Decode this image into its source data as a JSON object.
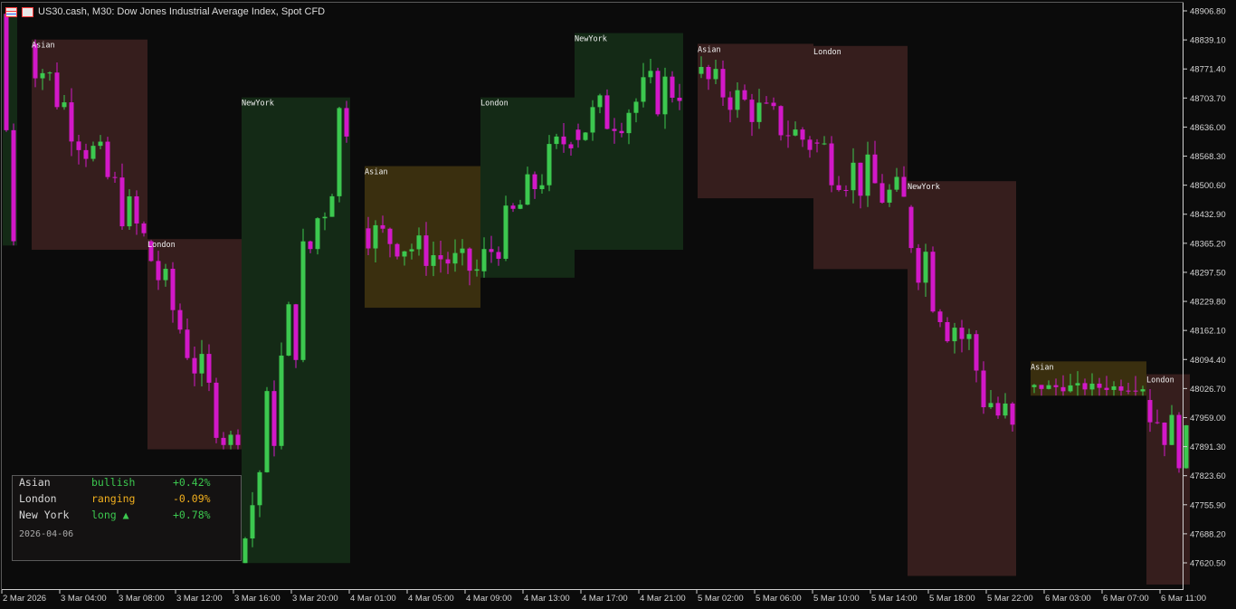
{
  "window": {
    "title": "US30.cash, M30:  Dow Jones Industrial Average Index, Spot CFD"
  },
  "colors": {
    "background": "#0b0b0b",
    "bull_candle": "#3cc84f",
    "bear_candle": "#d218c8",
    "asian_box": "#3a2f0f",
    "london_box": "#361e1d",
    "newyork_box": "#142a16",
    "axis_text": "#d4d4d4"
  },
  "price_axis": {
    "labels": [
      "48906.80",
      "48839.10",
      "48771.40",
      "48703.70",
      "48636.00",
      "48568.30",
      "48500.60",
      "48432.90",
      "48365.20",
      "48297.50",
      "48229.80",
      "48162.10",
      "48094.40",
      "48026.70",
      "47959.00",
      "47891.30",
      "47823.60",
      "47755.90",
      "47688.20",
      "47620.50"
    ]
  },
  "time_axis": {
    "labels": [
      "2 Mar 2026",
      "3 Mar 04:00",
      "3 Mar 08:00",
      "3 Mar 12:00",
      "3 Mar 16:00",
      "3 Mar 20:00",
      "4 Mar 01:00",
      "4 Mar 05:00",
      "4 Mar 09:00",
      "4 Mar 13:00",
      "4 Mar 17:00",
      "4 Mar 21:00",
      "5 Mar 02:00",
      "5 Mar 06:00",
      "5 Mar 10:00",
      "5 Mar 14:00",
      "5 Mar 18:00",
      "5 Mar 22:00",
      "6 Mar 03:00",
      "6 Mar 07:00",
      "6 Mar 11:00"
    ]
  },
  "sessions": [
    {
      "name": "",
      "type": "newyork",
      "open": 48900,
      "close": 48360,
      "high": 48900,
      "low": 48360
    },
    {
      "name": "Asian",
      "type": "london",
      "open": 48830,
      "close": 48370,
      "high": 48840,
      "low": 48350
    },
    {
      "name": "London",
      "type": "london",
      "open": 48370,
      "close": 47850,
      "high": 48375,
      "low": 47885
    },
    {
      "name": "NewYork",
      "type": "newyork",
      "open": 47620,
      "close": 48720,
      "high": 48705,
      "low": 47620
    },
    {
      "name": "Asian",
      "type": "asian",
      "open": 48400,
      "close": 48300,
      "high": 48545,
      "low": 48215
    },
    {
      "name": "London",
      "type": "newyork",
      "open": 48300,
      "close": 48630,
      "high": 48705,
      "low": 48285
    },
    {
      "name": "NewYork",
      "type": "newyork",
      "open": 48630,
      "close": 48740,
      "high": 48855,
      "low": 48350
    },
    {
      "name": "Asian",
      "type": "london",
      "open": 48760,
      "close": 48600,
      "high": 48830,
      "low": 48470
    },
    {
      "name": "London",
      "type": "london",
      "open": 48600,
      "close": 48450,
      "high": 48825,
      "low": 48305
    },
    {
      "name": "NewYork",
      "type": "london",
      "open": 48450,
      "close": 47890,
      "high": 48510,
      "low": 47590
    },
    {
      "name": "Asian",
      "type": "asian",
      "open": 48030,
      "close": 48030,
      "high": 48090,
      "low": 48010
    },
    {
      "name": "London",
      "type": "london",
      "open": 48000,
      "close": 47880,
      "high": 48060,
      "low": 47570
    }
  ],
  "panel": {
    "rows": [
      {
        "name": "Asian",
        "state": "bullish",
        "state_color": "#3cc84f",
        "pct": "+0.42%",
        "pct_color": "#3cc84f"
      },
      {
        "name": "London",
        "state": "ranging",
        "state_color": "#f2b01e",
        "pct": "-0.09%",
        "pct_color": "#f2b01e"
      },
      {
        "name": "New York",
        "state": "long ▲",
        "state_color": "#3cc84f",
        "pct": "+0.78%",
        "pct_color": "#3cc84f"
      }
    ],
    "date": "2026-04-06"
  }
}
